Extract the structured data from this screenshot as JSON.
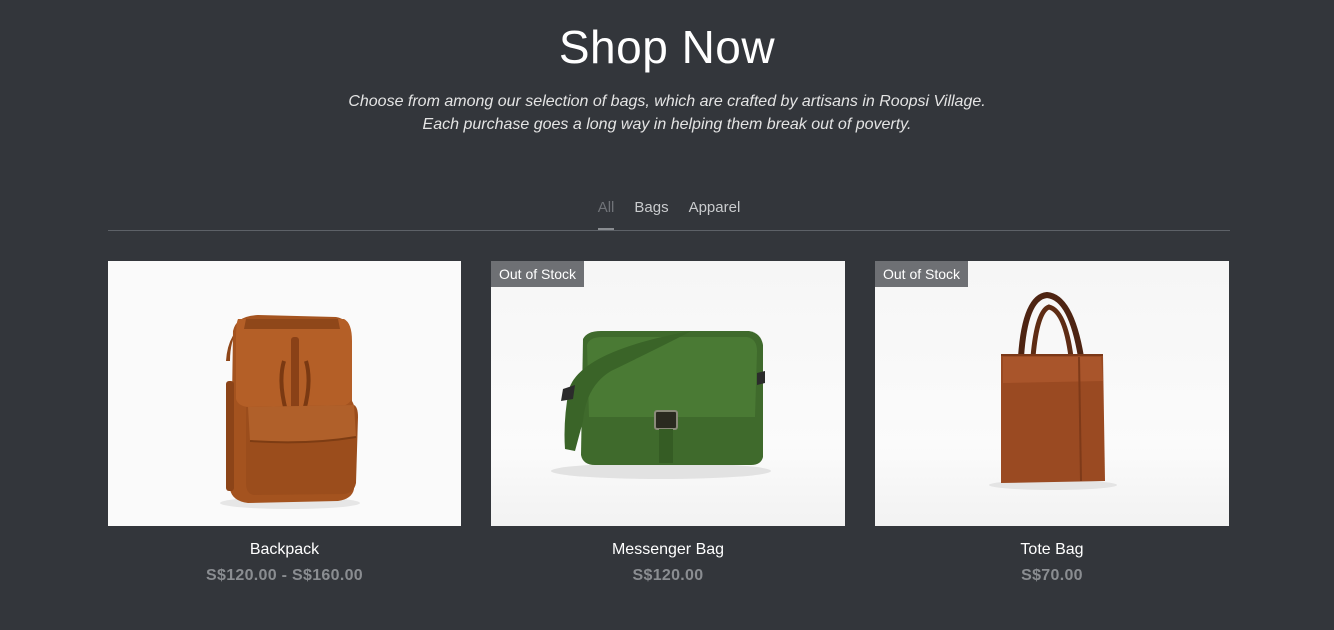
{
  "header": {
    "title": "Shop Now",
    "subtitle_line1": "Choose from among our selection of bags, which are crafted by artisans in Roopsi Village.",
    "subtitle_line2": "Each purchase goes a long way in helping them break out of poverty."
  },
  "filters": [
    {
      "label": "All",
      "active": true
    },
    {
      "label": "Bags",
      "active": false
    },
    {
      "label": "Apparel",
      "active": false
    }
  ],
  "products": [
    {
      "name": "Backpack",
      "price": "S$120.00 - S$160.00",
      "badge": "",
      "image": "brown-leather-backpack"
    },
    {
      "name": "Messenger Bag",
      "price": "S$120.00",
      "badge": "Out of Stock",
      "image": "green-leather-messenger-bag"
    },
    {
      "name": "Tote Bag",
      "price": "S$70.00",
      "badge": "Out of Stock",
      "image": "brown-leather-tote-bag"
    }
  ],
  "colors": {
    "background": "#33363b",
    "badge": "#6e7074",
    "price": "#8a8d91"
  }
}
